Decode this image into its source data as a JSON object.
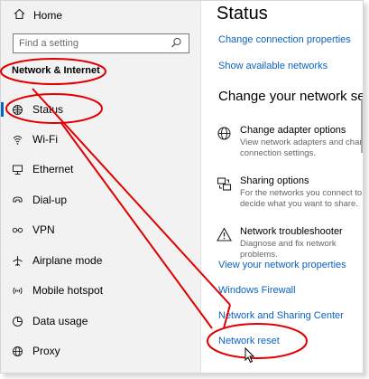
{
  "sidebar": {
    "home_label": "Home",
    "search_placeholder": "Find a setting",
    "category": "Network & Internet",
    "items": [
      {
        "label": "Status",
        "icon": "globe-icon"
      },
      {
        "label": "Wi-Fi",
        "icon": "wifi-icon"
      },
      {
        "label": "Ethernet",
        "icon": "ethernet-icon"
      },
      {
        "label": "Dial-up",
        "icon": "dialup-icon"
      },
      {
        "label": "VPN",
        "icon": "vpn-icon"
      },
      {
        "label": "Airplane mode",
        "icon": "airplane-icon"
      },
      {
        "label": "Mobile hotspot",
        "icon": "hotspot-icon"
      },
      {
        "label": "Data usage",
        "icon": "data-usage-icon"
      },
      {
        "label": "Proxy",
        "icon": "globe-icon"
      }
    ]
  },
  "main": {
    "title": "Status",
    "links_top": [
      "Change connection properties",
      "Show available networks"
    ],
    "section_title": "Change your network settings",
    "options": [
      {
        "title": "Change adapter options",
        "description": "View network adapters and change connection settings.",
        "icon": "adapter-globe-icon"
      },
      {
        "title": "Sharing options",
        "description": "For the networks you connect to, decide what you want to share.",
        "icon": "sharing-icon"
      },
      {
        "title": "Network troubleshooter",
        "description": "Diagnose and fix network problems.",
        "icon": "warning-icon"
      }
    ],
    "links_bottom": [
      "View your network properties",
      "Windows Firewall",
      "Network and Sharing Center",
      "Network reset"
    ]
  },
  "annotation_color": "#e00000",
  "accent_color": "#0067c0",
  "link_color": "#0a62c2"
}
